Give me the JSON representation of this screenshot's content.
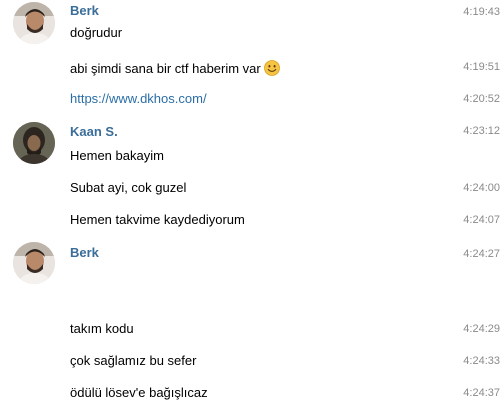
{
  "groups": [
    {
      "sender": "Berk",
      "avatar_icon": "berk-avatar",
      "messages": [
        {
          "text": "doğrudur",
          "time": "4:19:43"
        },
        {
          "text": "abi şimdi sana bir ctf haberim var",
          "time": "4:19:51",
          "emoji": "smiling-face-emoji"
        },
        {
          "text": "https://www.dkhos.com/",
          "time": "4:20:52",
          "type": "link"
        }
      ]
    },
    {
      "sender": "Kaan S.",
      "avatar_icon": "kaan-avatar",
      "messages": [
        {
          "text": "Hemen bakayim",
          "time": "4:23:12"
        },
        {
          "text": "Subat ayi, cok guzel",
          "time": "4:24:00"
        },
        {
          "text": "Hemen takvime kaydediyorum",
          "time": "4:24:07"
        }
      ]
    },
    {
      "sender": "Berk",
      "avatar_icon": "berk-avatar",
      "messages": [
        {
          "text": "",
          "time": "4:24:27"
        },
        {
          "text": "takım kodu",
          "time": "4:24:29"
        },
        {
          "text": "çok sağlamız bu sefer",
          "time": "4:24:33"
        },
        {
          "text": "ödülü lösev'e bağışlıcaz",
          "time": "4:24:37"
        }
      ]
    }
  ],
  "colors": {
    "sender": "#3a6d99",
    "link": "#2b6ea6",
    "timestamp": "#8a8a8a"
  }
}
